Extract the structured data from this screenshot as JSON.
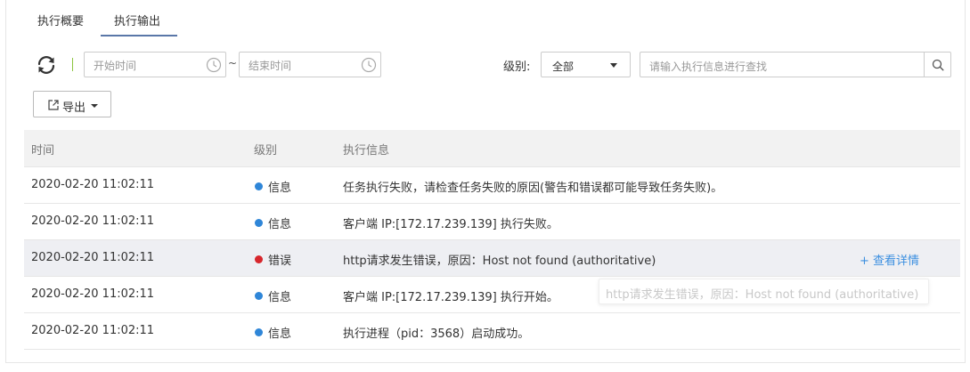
{
  "tabs": [
    {
      "label": "执行概要",
      "active": false
    },
    {
      "label": "执行输出",
      "active": true
    }
  ],
  "filters": {
    "start_time_placeholder": "开始时间",
    "range_separator": "~",
    "end_time_placeholder": "结束时间",
    "level_label": "级别:",
    "level_value": "全部",
    "search_placeholder": "请输入执行信息进行查找"
  },
  "toolbar": {
    "export_label": "导出",
    "icons": [
      "refresh-icon",
      "clock-icon",
      "search-icon",
      "export-icon",
      "chevron-down-icon"
    ]
  },
  "colors": {
    "info": "#2f86d8",
    "error": "#d7262c",
    "link": "#3c8fe0",
    "tab_underline": "#5a77a8",
    "separator": "#8bc53f"
  },
  "table": {
    "columns": [
      "时间",
      "级别",
      "执行信息"
    ],
    "rows": [
      {
        "time": "2020-02-20 11:02:11",
        "level": "信息",
        "level_color": "#2f86d8",
        "message": "任务执行失败，请检查任务失败的原因(警告和错误都可能导致任务失败)。"
      },
      {
        "time": "2020-02-20 11:02:11",
        "level": "信息",
        "level_color": "#2f86d8",
        "message": "客户端 IP:[172.17.239.139] 执行失败。"
      },
      {
        "time": "2020-02-20 11:02:11",
        "level": "错误",
        "level_color": "#d7262c",
        "message": "http请求发生错误，原因：Host not found (authoritative)",
        "detail_link": "+ 查看详情"
      },
      {
        "time": "2020-02-20 11:02:11",
        "level": "信息",
        "level_color": "#2f86d8",
        "message": "客户端 IP:[172.17.239.139] 执行开始。"
      },
      {
        "time": "2020-02-20 11:02:11",
        "level": "信息",
        "level_color": "#2f86d8",
        "message": "执行进程（pid：3568）启动成功。"
      }
    ]
  },
  "tooltip": {
    "text": "http请求发生错误，原因：Host not found (authoritative)"
  }
}
